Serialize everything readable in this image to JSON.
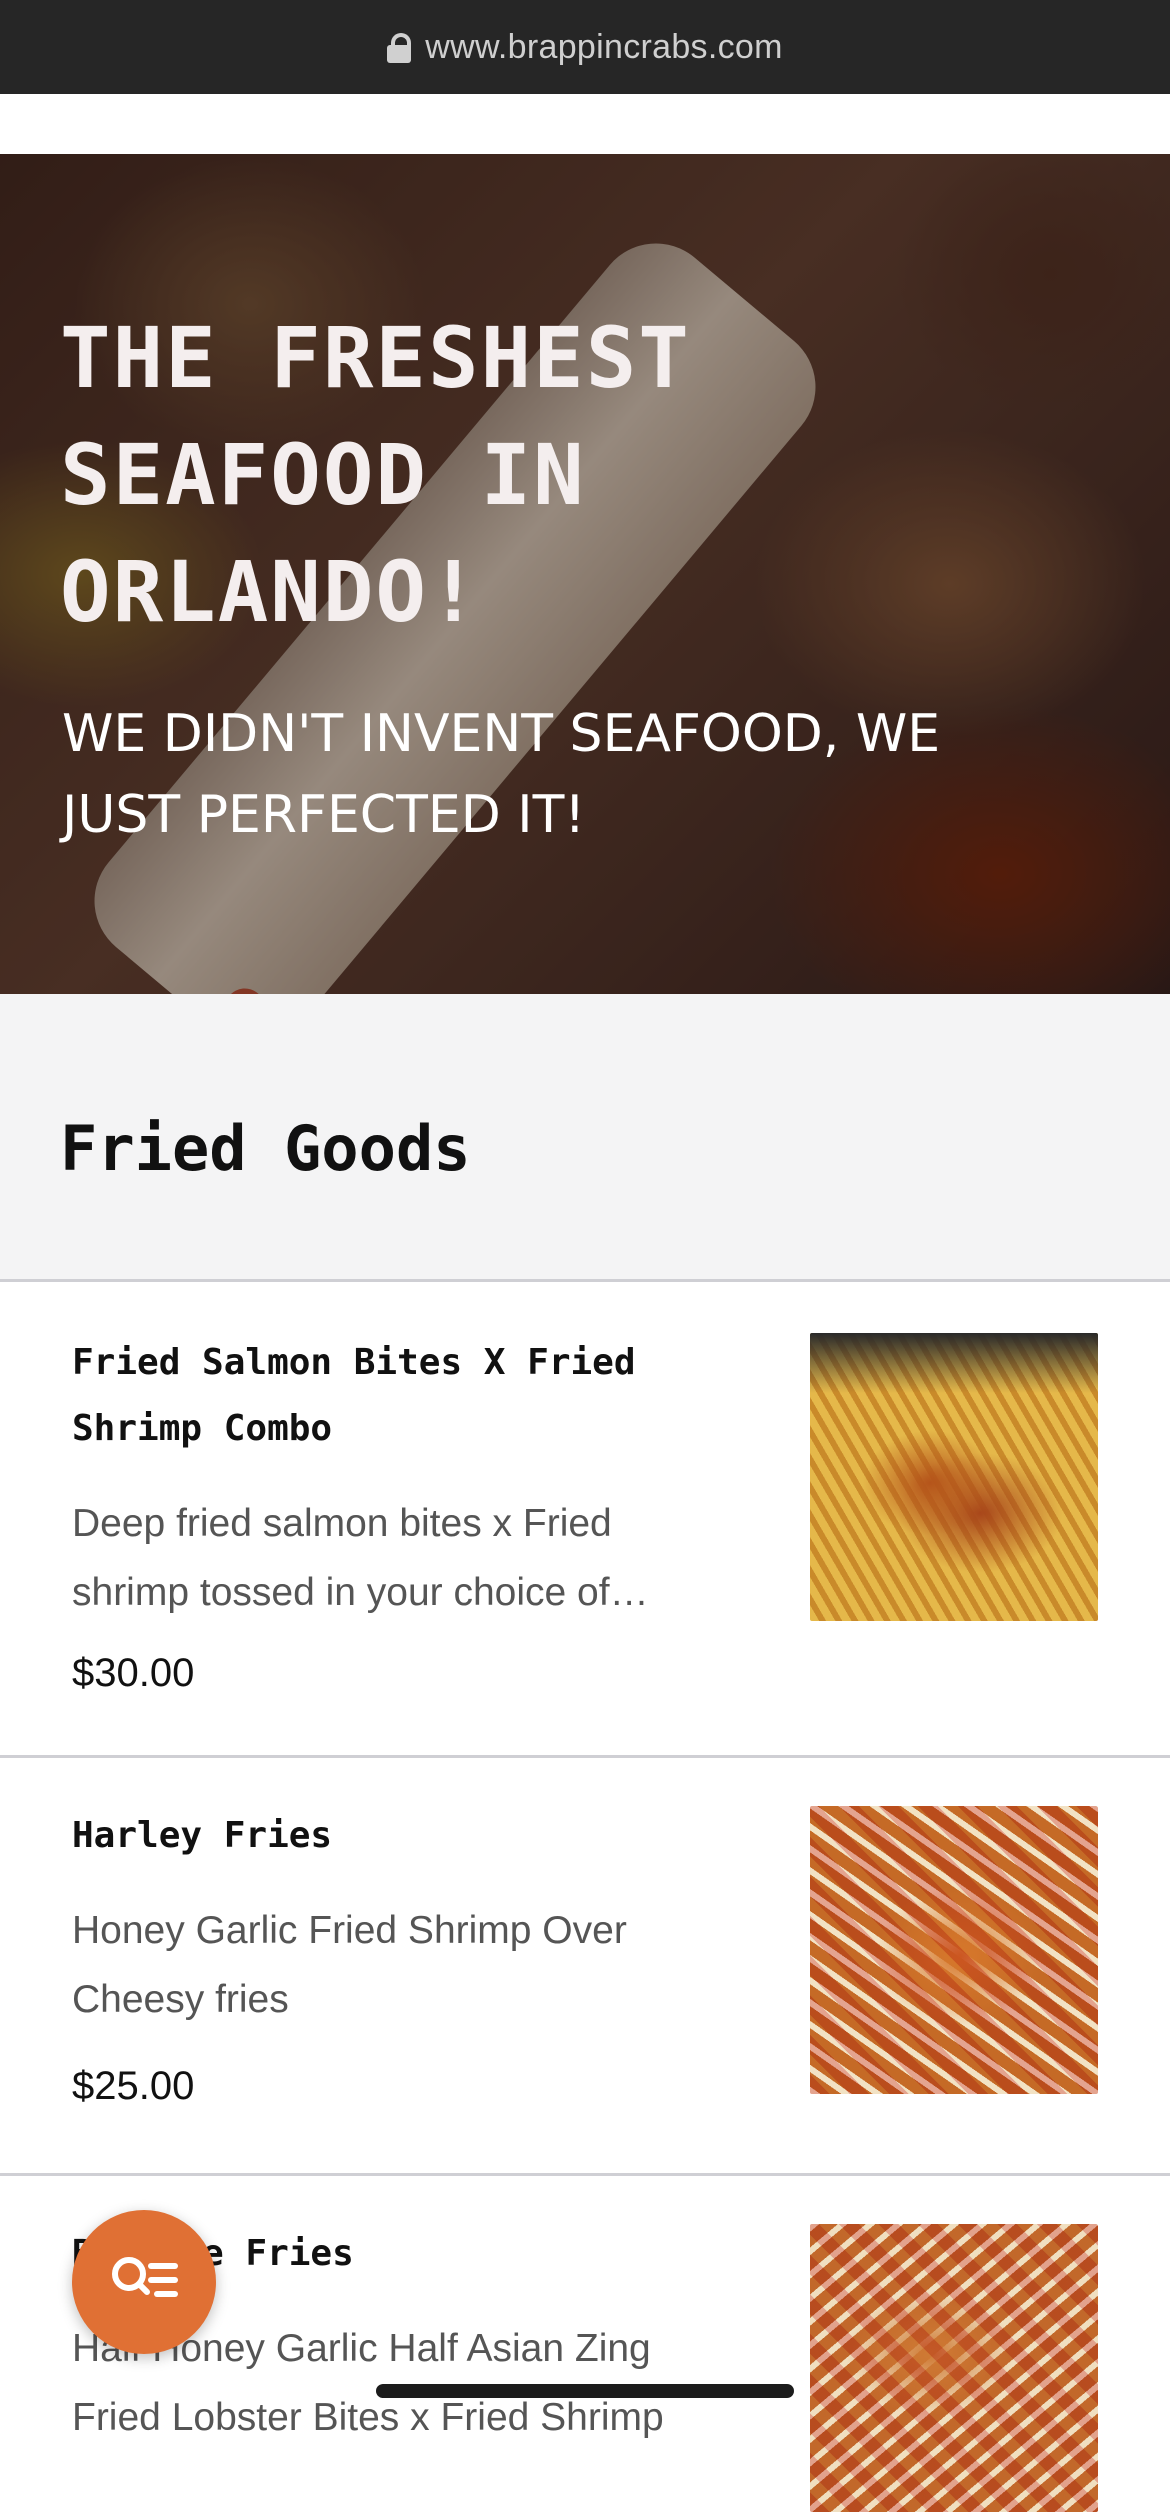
{
  "browser": {
    "url": "www.brappincrabs.com"
  },
  "hero": {
    "title": "THE FRESHEST SEAFOOD IN ORLANDO!",
    "subtitle": "WE DIDN'T INVENT SEAFOOD, WE JUST PERFECTED IT!"
  },
  "section": {
    "title": "Fried Goods"
  },
  "menu_items": [
    {
      "name": "Fried Salmon Bites X Fried Shrimp Combo",
      "description": "Deep fried salmon bites x Fried shrimp tossed in your choice of…",
      "price": "$30.00"
    },
    {
      "name": "Harley Fries",
      "description": "Honey Garlic Fried Shrimp Over Cheesy fries",
      "price": "$25.00"
    },
    {
      "name": "Brappee Fries",
      "description": "Half Honey Garlic Half Asian Zing Fried Lobster Bites x Fried Shrimp",
      "price": ""
    }
  ],
  "icons": {
    "fab": "search-menu-icon",
    "lock": "lock-icon"
  },
  "colors": {
    "accent": "#e07034",
    "url_bar": "#262626",
    "section_bg": "#f4f4f5"
  }
}
